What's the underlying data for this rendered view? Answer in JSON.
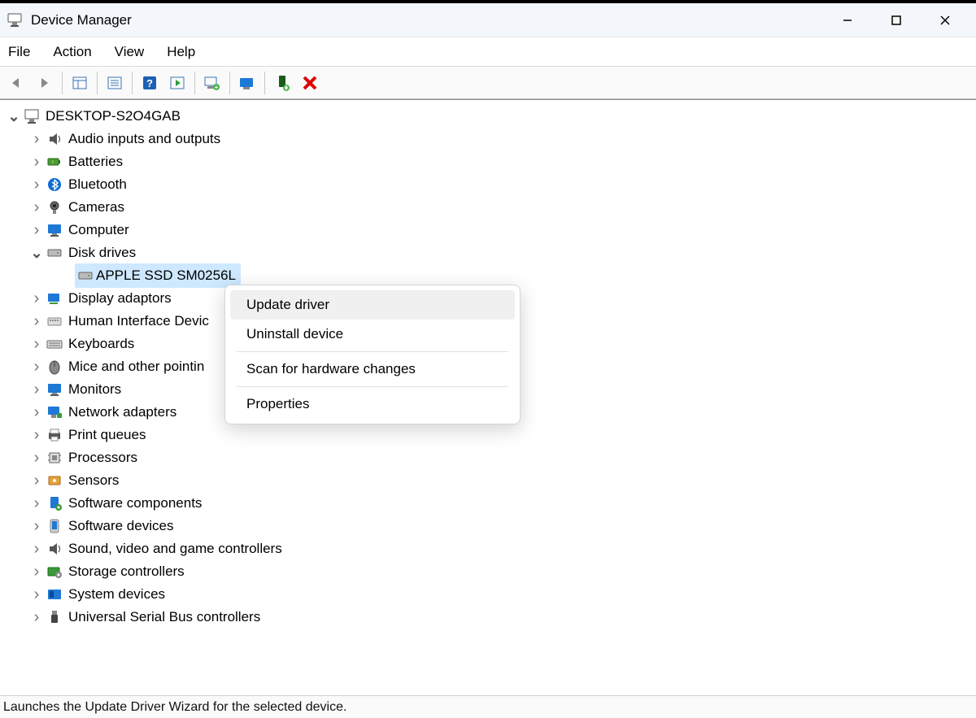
{
  "window": {
    "title": "Device Manager"
  },
  "menu": {
    "file": "File",
    "action": "Action",
    "view": "View",
    "help": "Help"
  },
  "tree": {
    "root": "DESKTOP-S2O4GAB",
    "audio": "Audio inputs and outputs",
    "batteries": "Batteries",
    "bluetooth": "Bluetooth",
    "cameras": "Cameras",
    "computer": "Computer",
    "diskdrives": "Disk drives",
    "disk_child": "APPLE SSD SM0256L",
    "display": "Display adaptors",
    "hid": "Human Interface Devic",
    "keyboards": "Keyboards",
    "mice": "Mice and other pointin",
    "monitors": "Monitors",
    "network": "Network adapters",
    "printqueues": "Print queues",
    "processors": "Processors",
    "sensors": "Sensors",
    "swcomponents": "Software components",
    "swdevices": "Software devices",
    "sound": "Sound, video and game controllers",
    "storage": "Storage controllers",
    "system": "System devices",
    "usb": "Universal Serial Bus controllers"
  },
  "context": {
    "update": "Update driver",
    "uninstall": "Uninstall device",
    "scan": "Scan for hardware changes",
    "properties": "Properties"
  },
  "status": "Launches the Update Driver Wizard for the selected device."
}
